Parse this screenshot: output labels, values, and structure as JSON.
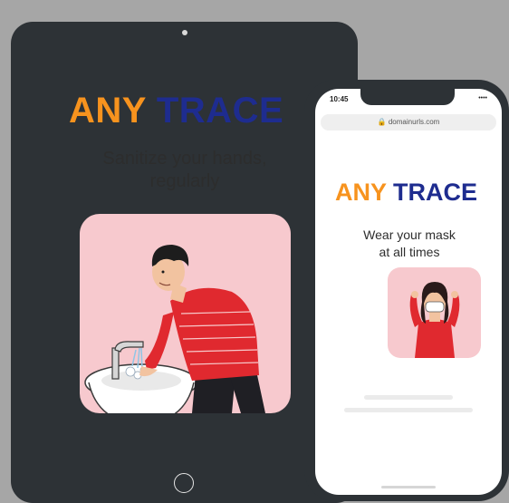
{
  "tablet": {
    "brand_part1": "ANY",
    "brand_part2": "TRACE",
    "caption_line1": "Sanitize your hands,",
    "caption_line2": "regularly",
    "illustration": "man-washing-hands"
  },
  "phone": {
    "time": "10:45",
    "status": "••••",
    "url": "domainurls.com",
    "brand_part1": "ANY",
    "brand_part2": "TRACE",
    "caption_line1": "Wear your mask",
    "caption_line2": "at all times",
    "illustration": "woman-wearing-mask"
  },
  "colors": {
    "background": "#a6a6a6",
    "device_frame": "#2d3236",
    "brand_orange": "#f7931e",
    "brand_navy": "#1e2c8f",
    "illustration_bg": "#f7c9ce",
    "shirt_red": "#e0292f"
  }
}
